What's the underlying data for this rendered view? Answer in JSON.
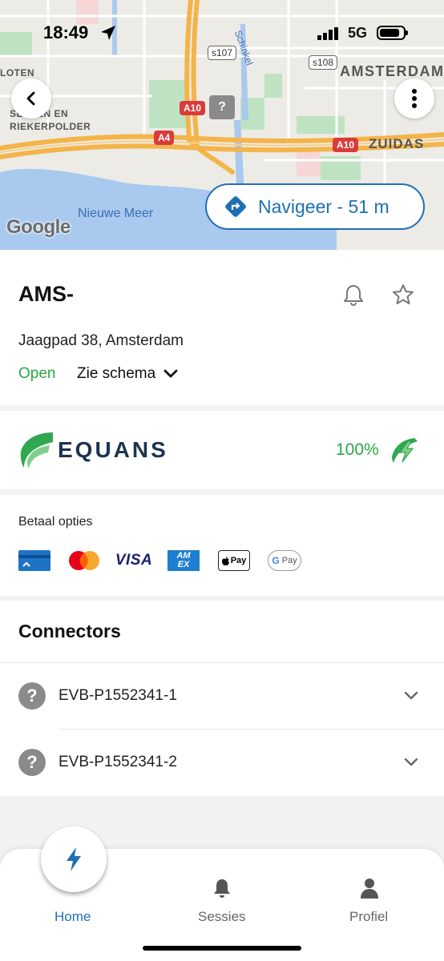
{
  "status_bar": {
    "time": "18:49",
    "network": "5G"
  },
  "map": {
    "labels": {
      "loten": "LOTEN",
      "sloten_en": "SLOTEN EN",
      "riekerpolder": "RIEKERPOLDER",
      "amsterdam": "AMSTERDAM",
      "zuidas": "ZUIDAS",
      "schinkel": "Schinkel",
      "nieuwe_meer": "Nieuwe Meer",
      "s107": "s107",
      "s108": "s108",
      "a10_left": "A10",
      "a10_right": "A10",
      "a4": "A4",
      "poi": "?"
    },
    "google": "Google",
    "navigate_label": "Navigeer - 51 m"
  },
  "station": {
    "title": "AMS-",
    "address": "Jaagpad 38, Amsterdam",
    "status": "Open",
    "schedule_label": "Zie schema"
  },
  "operator": {
    "name": "EQUANS",
    "availability": "100%"
  },
  "payment": {
    "title": "Betaal opties",
    "methods": [
      "card",
      "mastercard",
      "visa",
      "amex",
      "apple-pay",
      "google-pay"
    ],
    "visa_text": "VISA",
    "amex_text": "AM EX",
    "applepay_text": "Pay",
    "googlepay_text": "Pay"
  },
  "connectors": {
    "title": "Connectors",
    "items": [
      {
        "id": "EVB-P1552341-1",
        "status_icon": "?"
      },
      {
        "id": "EVB-P1552341-2",
        "status_icon": "?"
      }
    ]
  },
  "tabs": [
    {
      "label": "Home"
    },
    {
      "label": "Sessies"
    },
    {
      "label": "Profiel"
    }
  ],
  "colors": {
    "accent": "#1f6fb5",
    "open": "#28a745",
    "equans_navy": "#1d3350",
    "equans_green": "#2fa84f"
  }
}
